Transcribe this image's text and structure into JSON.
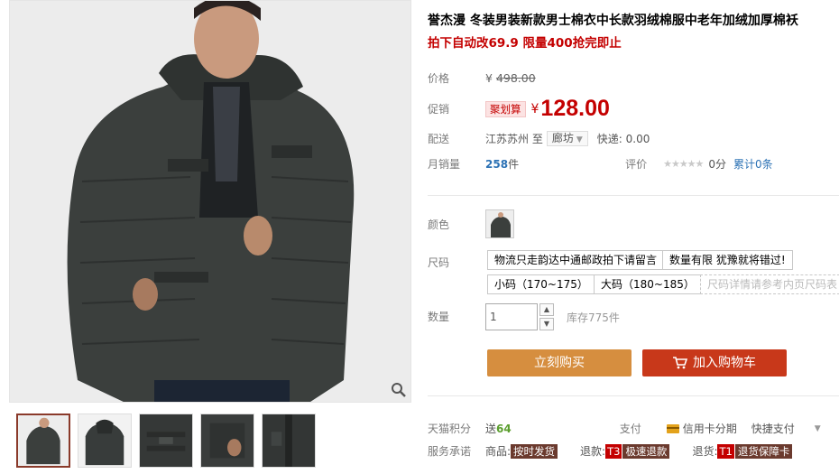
{
  "product": {
    "title": "誉杰漫 冬装男装新款男士棉衣中长款羽绒棉服中老年加绒加厚棉袄",
    "promo_note": "拍下自动改69.9 限量400抢完即止"
  },
  "price": {
    "label": "价格",
    "currency": "¥",
    "original": "498.00"
  },
  "promotion": {
    "label": "促销",
    "badge": "聚划算",
    "currency": "¥",
    "price": "128.00"
  },
  "shipping": {
    "label": "配送",
    "from": "江苏苏州 至",
    "to": "廊坊",
    "fee": "快递: 0.00"
  },
  "sales": {
    "label": "月销量",
    "count": "258",
    "unit": "件",
    "rating_label": "评价",
    "stars": "★★★★★",
    "score": "0分",
    "reviews": "累计0条"
  },
  "color": {
    "label": "颜色"
  },
  "size": {
    "label": "尺码",
    "options": [
      "物流只走韵达中通邮政拍下请留言",
      "数量有限 犹豫就将错过!",
      "小码（170~175）",
      "大码（180~185）"
    ],
    "hint": "尺码详情请参考内页尺码表"
  },
  "quantity": {
    "label": "数量",
    "value": "1",
    "stock": "库存775件"
  },
  "actions": {
    "buy": "立刻购买",
    "cart": "加入购物车"
  },
  "points": {
    "label": "天猫积分",
    "give": "送",
    "amount": "64"
  },
  "payment": {
    "label": "支付",
    "credit": "信用卡分期",
    "quick": "快捷支付"
  },
  "service": {
    "label": "服务承诺",
    "goods_label": "商品:",
    "goods_tag": "按时发货",
    "refund_label": "退款:",
    "refund_t": "T3",
    "refund_tag": "极速退款",
    "return_label": "退货:",
    "return_t": "T1",
    "return_tag": "退货保障卡"
  },
  "colors": {
    "accent_red": "#c40000",
    "buy_button": "#d68e3f",
    "cart_button": "#c8381a",
    "link_blue": "#2c72b5"
  }
}
